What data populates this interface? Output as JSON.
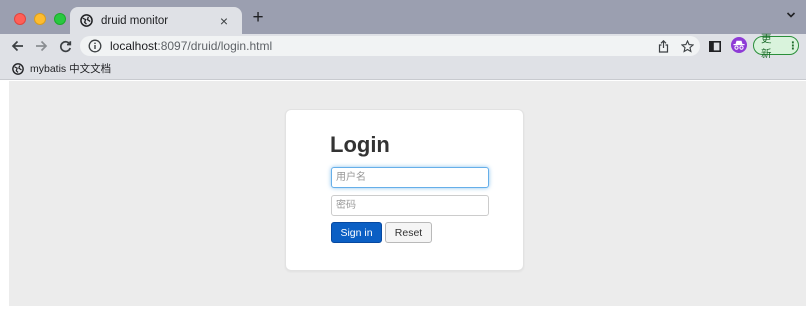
{
  "browser": {
    "tab": {
      "title": "druid monitor",
      "close_label": "×"
    },
    "new_tab_label": "+",
    "address": {
      "host": "localhost",
      "rest": ":8097/druid/login.html"
    },
    "update_label": "更新",
    "update_menu": "⋮",
    "bookmarks": [
      {
        "label": "mybatis 中文文档"
      }
    ]
  },
  "page": {
    "title": "Login",
    "username_placeholder": "用户名",
    "password_placeholder": "密码",
    "signin_label": "Sign in",
    "reset_label": "Reset"
  },
  "colors": {
    "primary": "#0b5fc4",
    "tabstrip": "#9b9fb0",
    "toolbar": "#dfe1e6",
    "viewport": "#ececec"
  }
}
